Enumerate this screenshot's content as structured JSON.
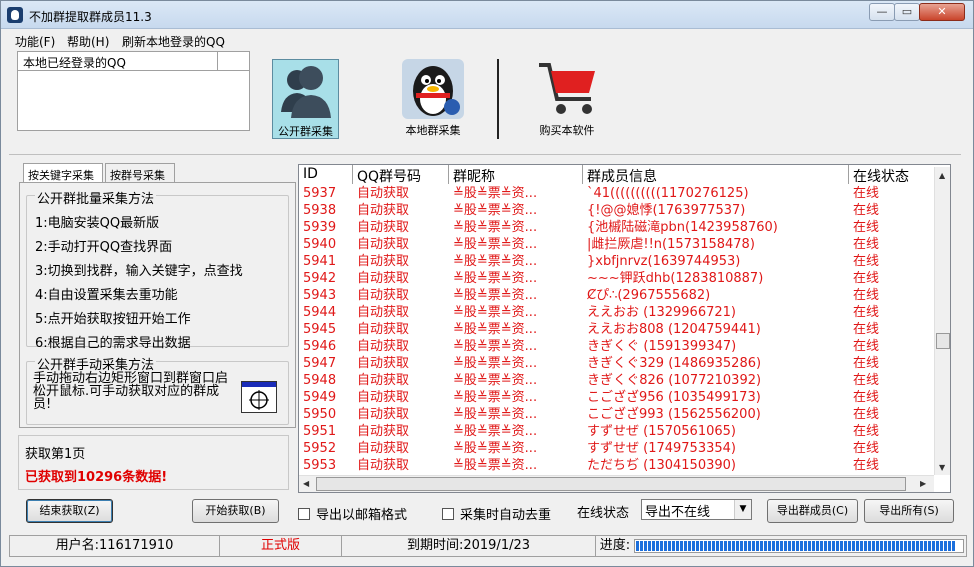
{
  "window": {
    "title": "不加群提取群成员11.3"
  },
  "menu": [
    "功能(F)",
    "帮助(H)",
    "刷新本地登录的QQ"
  ],
  "local_qq_panel": {
    "header": "本地已经登录的QQ"
  },
  "toolbar": {
    "public_group": "公开群采集",
    "local_group": "本地群采集",
    "buy": "购买本软件"
  },
  "tabs": [
    "按关键字采集",
    "按群号采集"
  ],
  "batch_method": {
    "title": "公开群批量采集方法",
    "steps": [
      "1:电脑安装QQ最新版",
      "2:手动打开QQ查找界面",
      "3:切换到找群，输入关键字，点查找",
      "4:自由设置采集去重功能",
      "5:点开始获取按钮开始工作",
      "6:根据自己的需求导出数据"
    ]
  },
  "manual_method": {
    "title": "公开群手动采集方法",
    "text": "手动拖动右边矩形窗口到群窗口启松开鼠标.可手动获取对应的群成员!"
  },
  "page_status": {
    "title": "获取第1页",
    "message": "已获取到10296条数据!"
  },
  "grid": {
    "columns": [
      "ID",
      "QQ群号码",
      "群昵称",
      "群成员信息",
      "在线状态"
    ],
    "rows": [
      [
        "5937",
        "自动获取",
        "≚股≚票≚资...",
        "`41((((((((((1170276125)",
        "在线"
      ],
      [
        "5938",
        "自动获取",
        "≚股≚票≚资...",
        "{!@@媳悸(1763977537)",
        "在线"
      ],
      [
        "5939",
        "自动获取",
        "≚股≚票≚资...",
        "{池槭陆磁滝pbn(1423958760)",
        "在线"
      ],
      [
        "5940",
        "自动获取",
        "≚股≚票≚资...",
        "|雌拦厥虐!!n(1573158478)",
        "在线"
      ],
      [
        "5941",
        "自动获取",
        "≚股≚票≚资...",
        "}xbfjnrvz(1639744953)",
        "在线"
      ],
      [
        "5942",
        "自动获取",
        "≚股≚票≚资...",
        "~~~钾跃dhb(1283810887)",
        "在线"
      ],
      [
        "5943",
        "自动获取",
        "≚股≚票≚资...",
        "Ȼぴ∴(2967555682)",
        "在线"
      ],
      [
        "5944",
        "自动获取",
        "≚股≚票≚资...",
        "ええおお (1329966721)",
        "在线"
      ],
      [
        "5945",
        "自动获取",
        "≚股≚票≚资...",
        "ええおお808 (1204759441)",
        "在线"
      ],
      [
        "5946",
        "自动获取",
        "≚股≚票≚资...",
        "きぎくぐ (1591399347)",
        "在线"
      ],
      [
        "5947",
        "自动获取",
        "≚股≚票≚资...",
        "きぎくぐ329 (1486935286)",
        "在线"
      ],
      [
        "5948",
        "自动获取",
        "≚股≚票≚资...",
        "きぎくぐ826 (1077210392)",
        "在线"
      ],
      [
        "5949",
        "自动获取",
        "≚股≚票≚资...",
        "こござざ956 (1035499173)",
        "在线"
      ],
      [
        "5950",
        "自动获取",
        "≚股≚票≚资...",
        "こござざ993 (1562556200)",
        "在线"
      ],
      [
        "5951",
        "自动获取",
        "≚股≚票≚资...",
        "すずせぜ (1570561065)",
        "在线"
      ],
      [
        "5952",
        "自动获取",
        "≚股≚票≚资...",
        "すずせぜ (1749753354)",
        "在线"
      ],
      [
        "5953",
        "自动获取",
        "≚股≚票≚资...",
        "ただちぢ (1304150390)",
        "在线"
      ]
    ]
  },
  "controls": {
    "stop": "结束获取(Z)",
    "start": "开始获取(B)",
    "export_email": "导出以邮箱格式",
    "auto_dedupe": "采集时自动去重",
    "online_label": "在线状态",
    "online_select": "导出不在线",
    "export_members": "导出群成员(C)",
    "export_all": "导出所有(S)"
  },
  "status": {
    "user": "用户名:116171910",
    "edition": "正式版",
    "expiry": "到期时间:2019/1/23",
    "progress_label": "进度:",
    "progress_fraction": 0.98
  },
  "colors": {
    "red": "#e01818",
    "progress": "#1c6fdc",
    "selected_tool": "#a8dfe8"
  }
}
